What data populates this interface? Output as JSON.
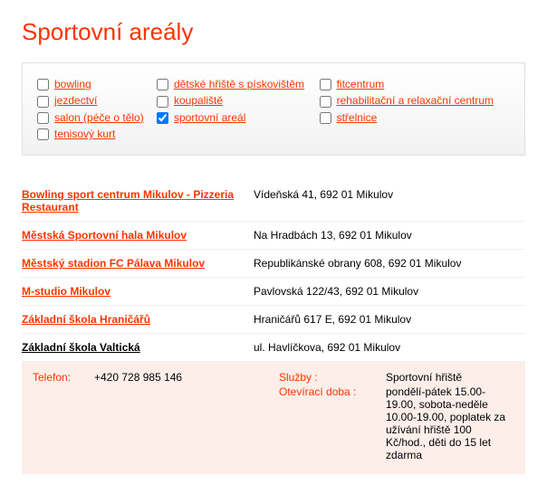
{
  "title": "Sportovní areály",
  "filters": [
    [
      {
        "label": "bowling",
        "checked": false
      },
      {
        "label": "dětské hřiště s pískovištěm",
        "checked": false
      },
      {
        "label": "fitcentrum",
        "checked": false
      }
    ],
    [
      {
        "label": "jezdectví",
        "checked": false
      },
      {
        "label": "koupaliště",
        "checked": false
      },
      {
        "label": "rehabilitační a relaxační centrum",
        "checked": false
      }
    ],
    [
      {
        "label": "salon (péče o tělo)",
        "checked": false
      },
      {
        "label": "sportovní areál",
        "checked": true
      },
      {
        "label": "střelnice",
        "checked": false
      }
    ],
    [
      {
        "label": "tenisový kurt",
        "checked": false
      }
    ]
  ],
  "results": [
    {
      "name": "Bowling sport centrum Mikulov - Pizzeria Restaurant",
      "address": "Vídeňská 41, 692 01 Mikulov"
    },
    {
      "name": "Městská Sportovní hala Mikulov",
      "address": "Na Hradbách 13, 692 01 Mikulov"
    },
    {
      "name": "Městský stadion FC Pálava Mikulov",
      "address": "Republikánské obrany 608, 692 01 Mikulov"
    },
    {
      "name": "M-studio Mikulov",
      "address": "Pavlovská 122/43, 692 01 Mikulov"
    },
    {
      "name": "Základní škola Hraničářů",
      "address": "Hraničářů 617 E, 692 01 Mikulov"
    },
    {
      "name": "Základní škola Valtická",
      "address": "ul. Havlíčkova, 692 01 Mikulov",
      "plain": true
    }
  ],
  "detail": {
    "phone_label": "Telefon:",
    "phone_value": "+420 728 985 146",
    "services_label": "Služby :",
    "services_value": "Sportovní hřiště",
    "hours_label": "Otevírací doba :",
    "hours_value": "pondělí-pátek 15.00-19.00, sobota-neděle 10.00-19.00, poplatek za užívání hřiště 100 Kč/hod., děti do 15 let zdarma"
  }
}
